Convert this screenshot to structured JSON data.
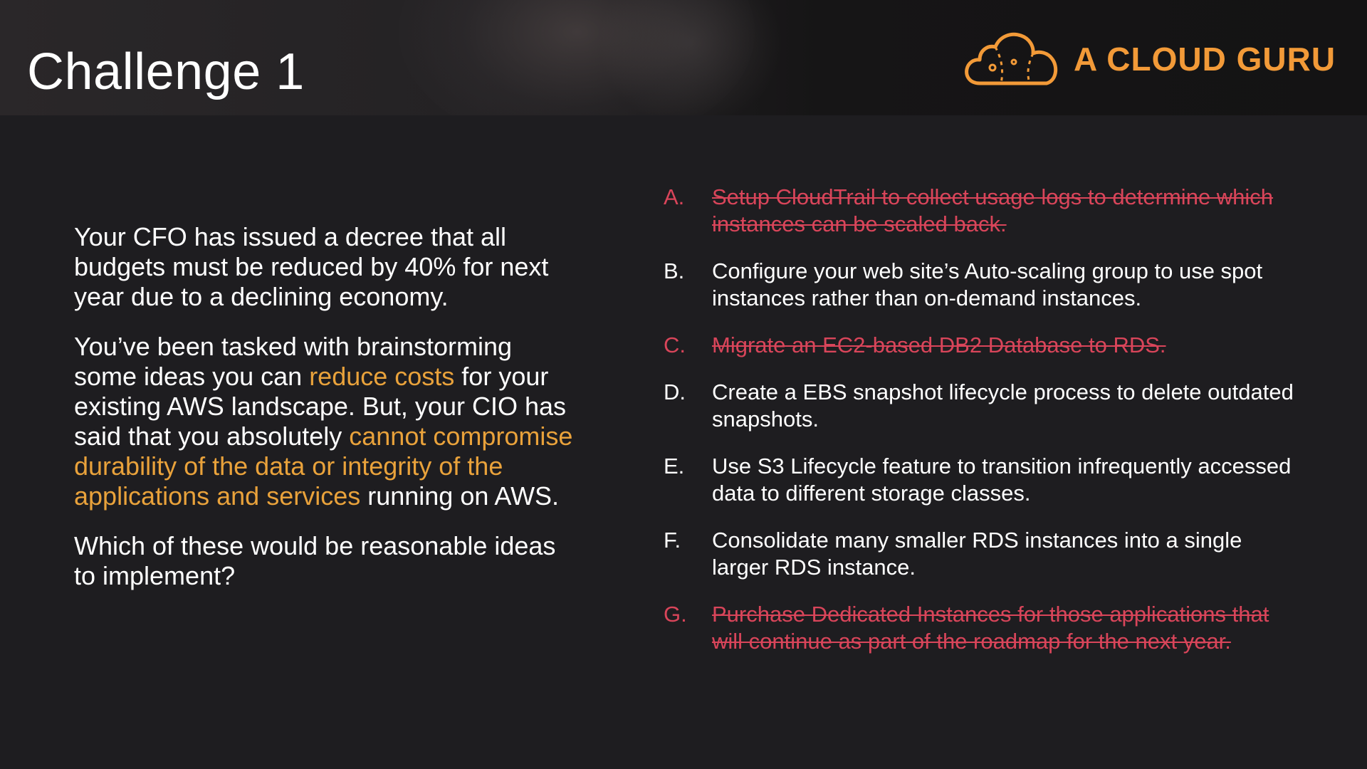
{
  "slide": {
    "title": "Challenge 1"
  },
  "brand": {
    "name": "A CLOUD GURU",
    "color": "#f29a38",
    "icon": "cloud-logo-icon"
  },
  "prompt": {
    "para1": "Your CFO has issued a decree that all budgets must be reduced by 40% for next year due to a declining economy.",
    "para2_a": "You’ve been tasked with brainstorming some ideas you can ",
    "para2_hl1": "reduce costs",
    "para2_b": " for your existing AWS landscape.  But, your CIO has said that you absolutely ",
    "para2_hl2": "cannot compromise durability of the data or integrity of the applications and services",
    "para2_c": " running on AWS.",
    "para3": "Which of these would be reasonable ideas to implement?"
  },
  "colors": {
    "highlight": "#e9a23b",
    "struck": "#d9455a",
    "text": "#ffffff",
    "background": "#1e1d20"
  },
  "options": [
    {
      "letter": "A.",
      "text": "Setup CloudTrail to collect usage logs to determine which instances can be scaled back.",
      "struck": true
    },
    {
      "letter": "B.",
      "text": "Configure your web site’s Auto-scaling group to use spot instances rather than on-demand instances.",
      "struck": false
    },
    {
      "letter": "C.",
      "text": "Migrate an EC2-based DB2 Database to RDS.",
      "struck": true
    },
    {
      "letter": "D.",
      "text": "Create a EBS snapshot lifecycle process to delete outdated snapshots.",
      "struck": false
    },
    {
      "letter": "E.",
      "text": "Use S3 Lifecycle feature to transition infrequently accessed data to different storage classes.",
      "struck": false
    },
    {
      "letter": "F.",
      "text": "Consolidate many smaller RDS instances into a single larger RDS instance.",
      "struck": false
    },
    {
      "letter": "G.",
      "text": "Purchase Dedicated Instances for those applications that will continue as part of the roadmap for the next year.",
      "struck": true
    }
  ]
}
